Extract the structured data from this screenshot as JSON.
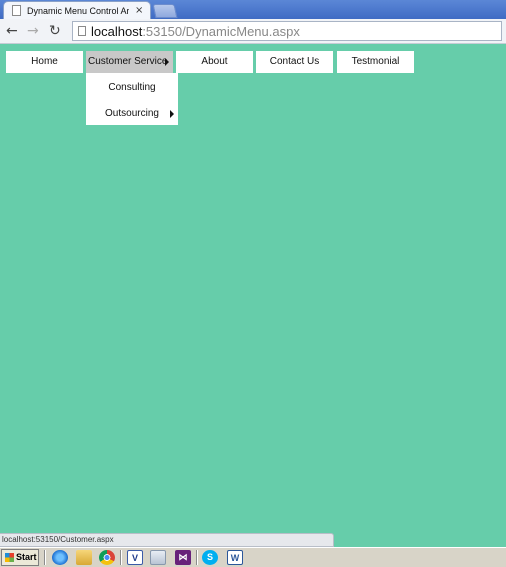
{
  "browser": {
    "tab_title": "Dynamic Menu Control Article",
    "tab_close_glyph": "×",
    "address_host": "localhost",
    "address_rest": ":53150/DynamicMenu.aspx"
  },
  "menu": {
    "items": [
      {
        "label": "Home"
      },
      {
        "label": "Customer Service",
        "active": true,
        "has_submenu": true
      },
      {
        "label": "About"
      },
      {
        "label": "Contact Us"
      },
      {
        "label": "Testmonial"
      }
    ],
    "submenu": [
      {
        "label": "Consulting"
      },
      {
        "label": "Outsourcing",
        "has_submenu": true
      }
    ]
  },
  "status_url": "localhost:53150/Customer.aspx",
  "taskbar": {
    "start_label": "Start",
    "icons": [
      "internet-explorer-icon",
      "folder-icon",
      "chrome-icon",
      "v-app-icon",
      "document-icon",
      "visual-studio-icon",
      "skype-icon",
      "word-icon"
    ],
    "v_label": "V",
    "vs_label": "⋈",
    "skype_label": "S",
    "word_label": "W"
  },
  "colors": {
    "page_background": "#66cdaa",
    "menu_background": "#ffffff",
    "menu_active": "#c8c8c8"
  }
}
